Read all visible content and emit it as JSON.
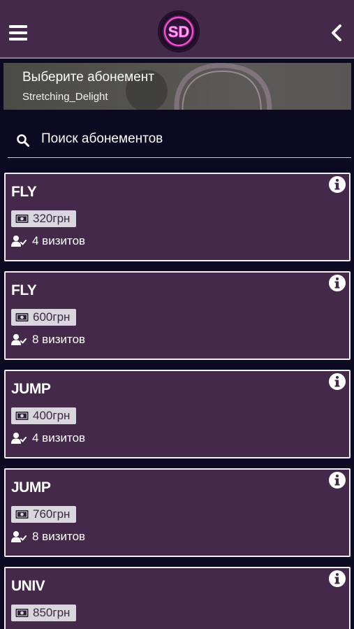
{
  "header": {
    "logo_text": "SD",
    "menu_icon": "hamburger-icon",
    "back_icon": "chevron-left-icon"
  },
  "banner": {
    "title": "Выберите абонемент",
    "subtitle": "Stretching_Delight"
  },
  "search": {
    "placeholder": "Поиск абонементов",
    "icon": "search-icon"
  },
  "cards": [
    {
      "title": "FLY",
      "price": "320грн",
      "visits": "4 визитов"
    },
    {
      "title": "FLY",
      "price": "600грн",
      "visits": "8 визитов"
    },
    {
      "title": "JUMP",
      "price": "400грн",
      "visits": "4 визитов"
    },
    {
      "title": "JUMP",
      "price": "760грн",
      "visits": "8 визитов"
    },
    {
      "title": "UNIV",
      "price": "850грн",
      "visits": ""
    }
  ],
  "colors": {
    "page_background": "#0b0a22",
    "header_background": "#44294a",
    "card_background": "#44294a",
    "card_border": "#f2eff4",
    "price_badge": "#d9d6de",
    "logo_accent": "#ff4fd8"
  }
}
